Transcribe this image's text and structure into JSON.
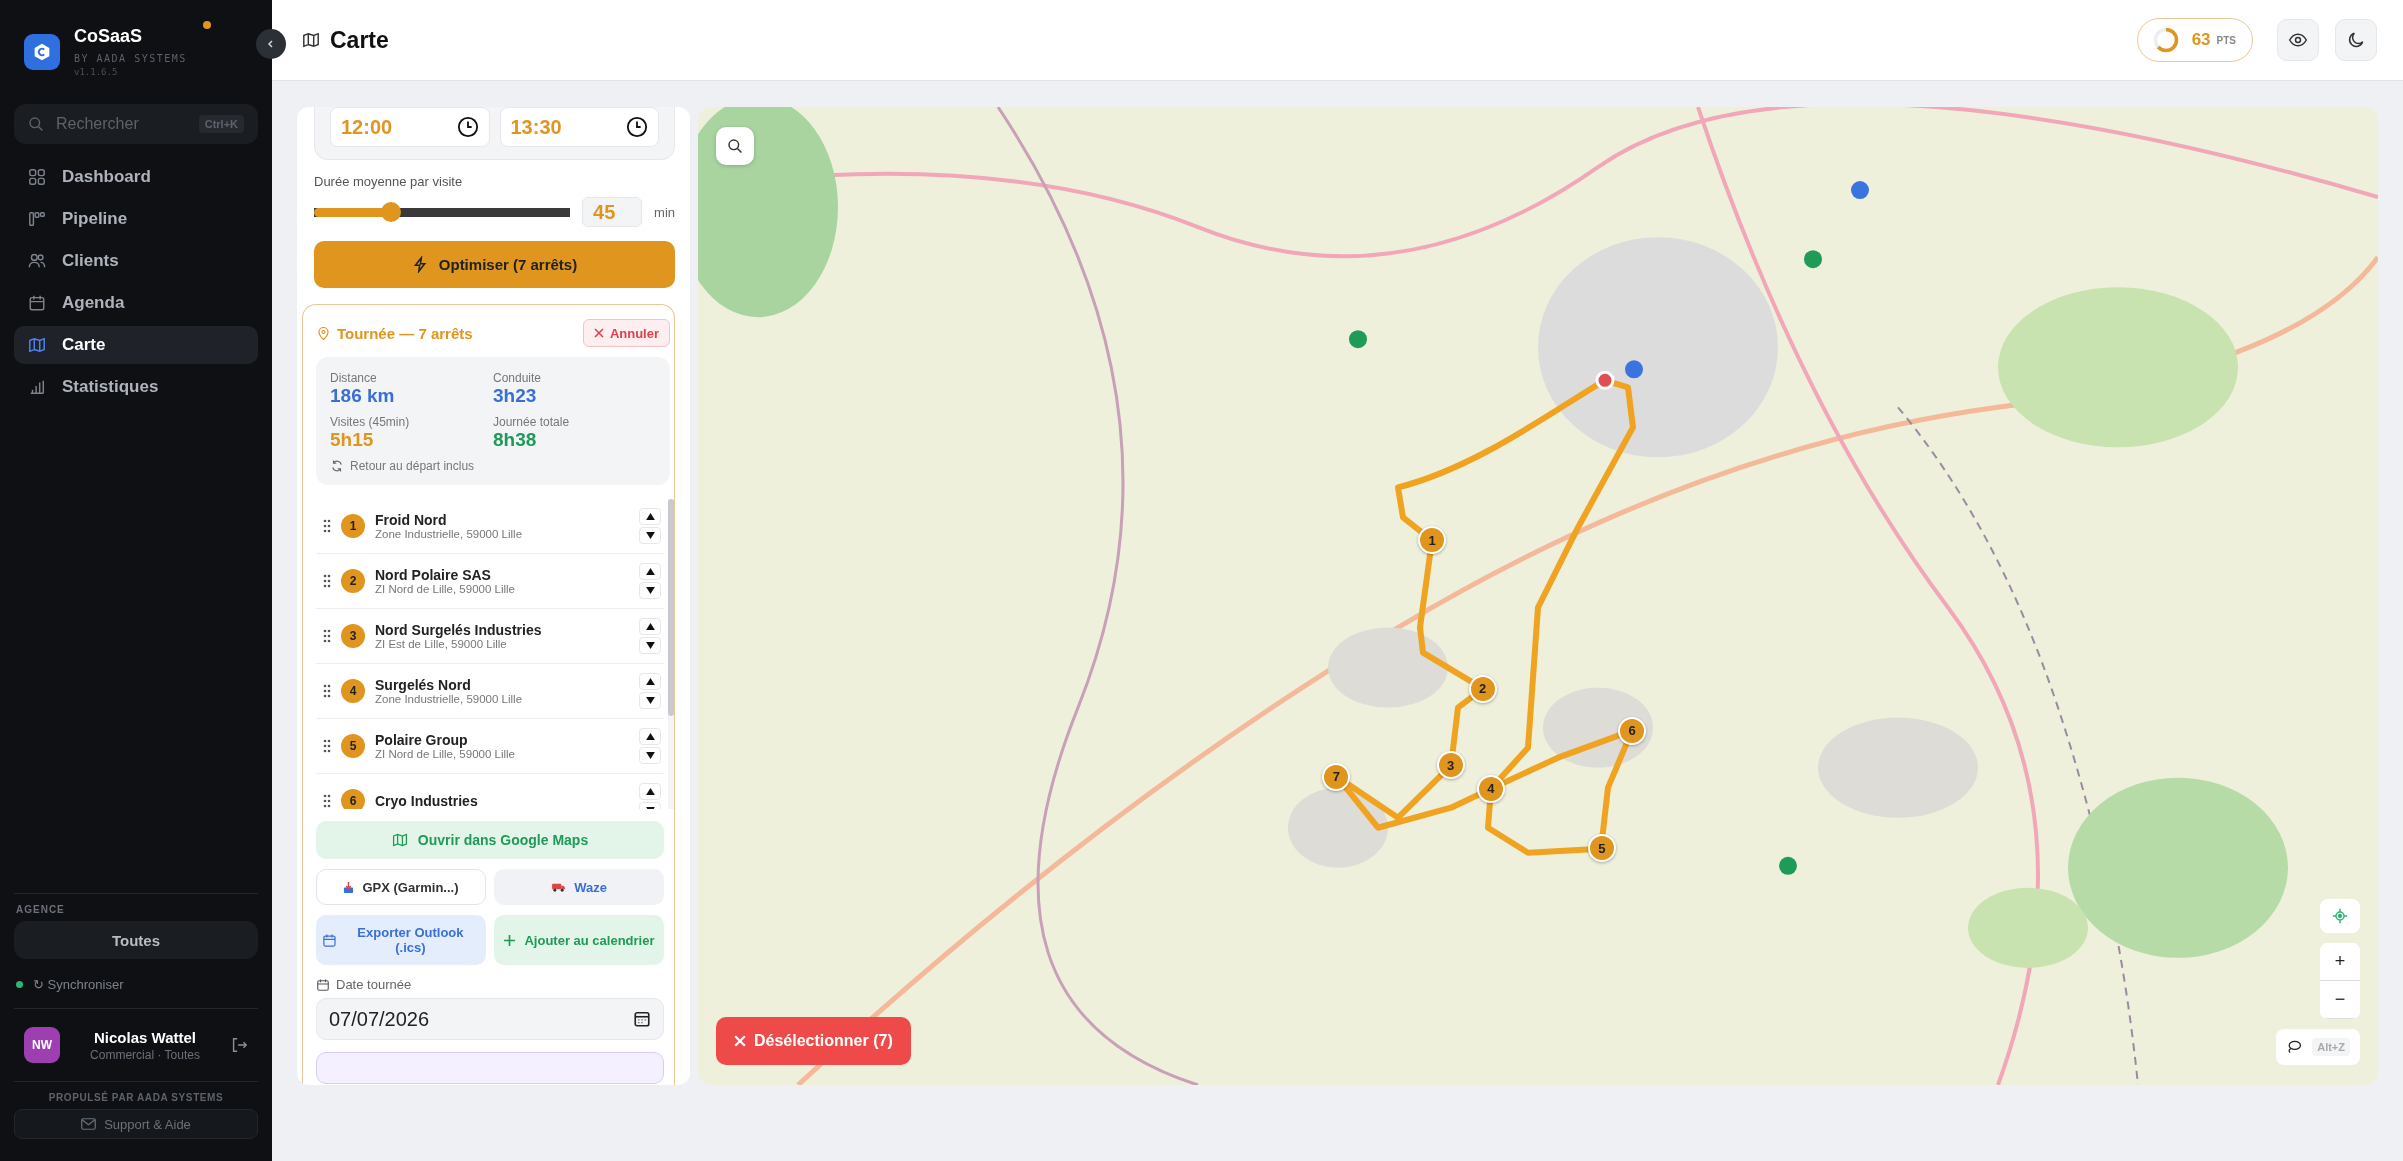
{
  "sidebar": {
    "brand": {
      "name": "CoSaaS",
      "tagline": "BY AADA SYSTEMS",
      "version": "v1.1.6.5",
      "notification": true
    },
    "search": {
      "placeholder": "Rechercher",
      "shortcut": "Ctrl+K"
    },
    "nav": [
      {
        "label": "Dashboard",
        "selected": false
      },
      {
        "label": "Pipeline",
        "selected": false
      },
      {
        "label": "Clients",
        "selected": false
      },
      {
        "label": "Agenda",
        "selected": false
      },
      {
        "label": "Carte",
        "selected": true
      },
      {
        "label": "Statistiques",
        "selected": false
      }
    ],
    "agency": {
      "label": "AGENCE",
      "value": "Toutes"
    },
    "sync": {
      "label": "↻ Synchroniser",
      "online": true
    },
    "user": {
      "initials": "NW",
      "name": "Nicolas Wattel",
      "role": "Commercial · Toutes"
    },
    "powered_by": "PROPULSÉ PAR AADA SYSTEMS",
    "support": "Support & Aide"
  },
  "header": {
    "title": "Carte",
    "score": {
      "value": "63",
      "unit": "PTS"
    }
  },
  "planner": {
    "times": [
      {
        "value": "12:00"
      },
      {
        "value": "13:30"
      }
    ],
    "duration": {
      "label": "Durée moyenne par visite",
      "level": 0.3,
      "value": "45",
      "unit": "min"
    },
    "optimize_button": "Optimiser (7 arrêts)",
    "tour": {
      "title": "Tournée — 7 arrêts",
      "cancel": "Annuler",
      "stats": [
        {
          "label": "Distance",
          "value": "186 km",
          "color": "#3b6fd8"
        },
        {
          "label": "Conduite",
          "value": "3h23",
          "color": "#3b6fd8"
        },
        {
          "label": "Visites (45min)",
          "value": "5h15",
          "color": "#e0951f"
        },
        {
          "label": "Journée totale",
          "value": "8h38",
          "color": "#1f9a57"
        }
      ],
      "return_note": "Retour au départ inclus",
      "stops": [
        {
          "number": "1",
          "name": "Froid Nord",
          "address": "Zone Industrielle, 59000 Lille"
        },
        {
          "number": "2",
          "name": "Nord Polaire SAS",
          "address": "ZI Nord de Lille, 59000 Lille"
        },
        {
          "number": "3",
          "name": "Nord Surgelés Industries",
          "address": "ZI Est de Lille, 59000 Lille"
        },
        {
          "number": "4",
          "name": "Surgelés Nord",
          "address": "Zone Industrielle, 59000 Lille"
        },
        {
          "number": "5",
          "name": "Polaire Group",
          "address": "ZI Nord de Lille, 59000 Lille"
        },
        {
          "number": "6",
          "name": "Cryo Industries"
        }
      ],
      "google_maps": "Ouvrir dans Google Maps",
      "gpx": "GPX (Garmin...)",
      "waze": "Waze",
      "outlook": "Exporter Outlook (.ics)",
      "add_calendar": "Ajouter au calendrier",
      "date": {
        "label": "Date tournée",
        "value": "07/07/2026"
      }
    }
  },
  "map": {
    "markers": [
      "1",
      "2",
      "3",
      "4",
      "5",
      "6",
      "7"
    ],
    "deselect_button": "Désélectionner (7)",
    "zoom_in": "+",
    "zoom_out": "−",
    "lasso_shortcut": "Alt+Z"
  }
}
